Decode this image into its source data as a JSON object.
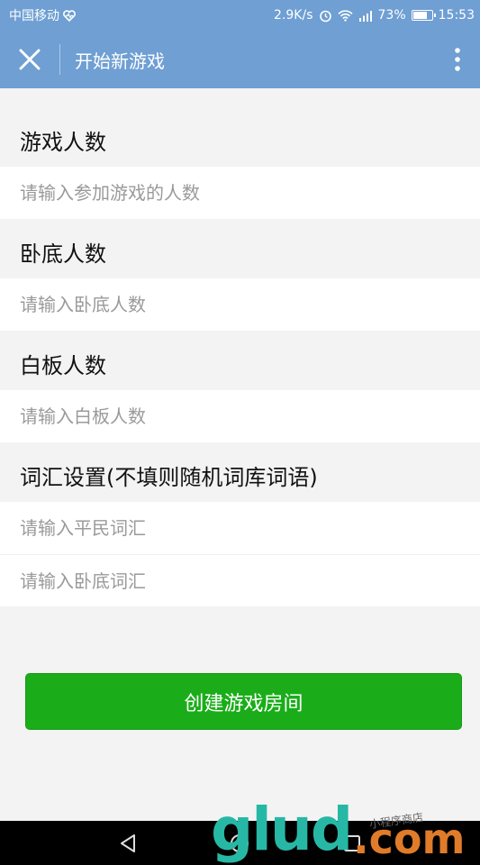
{
  "status_bar": {
    "carrier": "中国移动",
    "speed": "2.9K/s",
    "battery": "73%",
    "time": "15:53"
  },
  "header": {
    "title": "开始新游戏",
    "close_icon": "close-icon",
    "more_icon": "more-vertical-icon"
  },
  "sections": {
    "players": {
      "title": "游戏人数",
      "placeholder": "请输入参加游戏的人数"
    },
    "undercover": {
      "title": "卧底人数",
      "placeholder": "请输入卧底人数"
    },
    "blank": {
      "title": "白板人数",
      "placeholder": "请输入白板人数"
    },
    "words": {
      "title": "词汇设置(不填则随机词库词语)",
      "civilian_placeholder": "请输入平民词汇",
      "undercover_placeholder": "请输入卧底词汇"
    }
  },
  "create_button": {
    "label": "创建游戏房间",
    "color": "#1aad19"
  },
  "watermark": {
    "main": "glud",
    "suffix": ".com",
    "small": "小程序商店"
  },
  "colors": {
    "header": "#6f9fd3",
    "primary": "#1aad19"
  }
}
